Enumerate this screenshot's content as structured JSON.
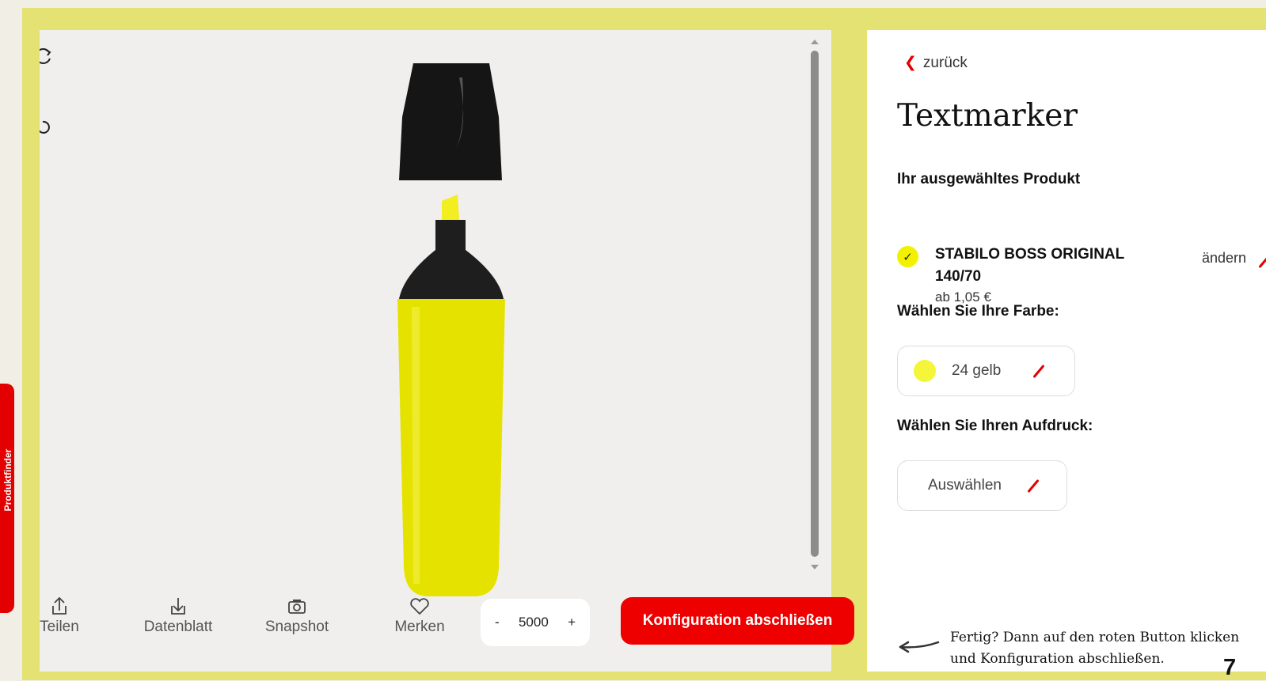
{
  "viewer": {
    "icons": {
      "refresh": "refresh-icon",
      "rotate": "rotate-3d-icon"
    }
  },
  "toolbar": {
    "share_label": "Teilen",
    "datasheet_label": "Datenblatt",
    "snapshot_label": "Snapshot",
    "remember_label": "Merken",
    "quantity": "5000",
    "decrement": "-",
    "increment": "+",
    "cta_label": "Konfiguration abschließen"
  },
  "panel": {
    "back_label": "zurück",
    "title": "Textmarker",
    "selected_product_label": "Ihr ausgewähltes Produkt",
    "product": {
      "name_line1": "STABILO BOSS ORIGINAL",
      "name_line2": "140/70",
      "price": "ab 1,05 €",
      "change_label": "ändern"
    },
    "color_label": "Wählen Sie Ihre Farbe:",
    "color_value": "24 gelb",
    "print_label": "Wählen Sie Ihren Aufdruck:",
    "print_value": "Auswählen",
    "hint": "Fertig? Dann auf den roten Button klicken und Konfiguration abschließen.",
    "page_number": "7"
  },
  "side_tab": {
    "label": "Produktfinder"
  },
  "colors": {
    "accent": "#ee0000",
    "frame": "#e3e273",
    "marker": "#e6e200"
  }
}
